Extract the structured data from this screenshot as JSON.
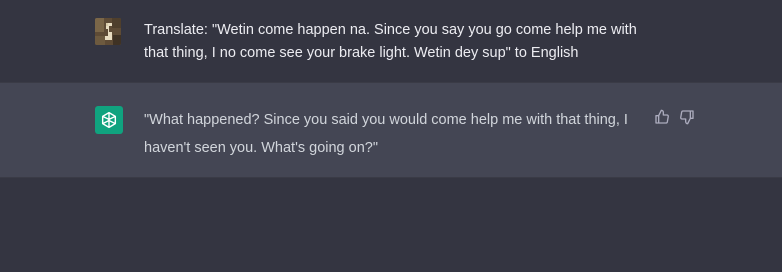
{
  "conversation": {
    "user_message": {
      "avatar_icon": "user-avatar-image",
      "text": "Translate: \"Wetin come happen na. Since you say you go come help me with that thing, I no come see your brake light. Wetin dey sup\" to English"
    },
    "assistant_message": {
      "avatar_icon": "openai-logo-icon",
      "text": "\"What happened? Since you said you would come help me with that thing, I haven't seen you. What's going on?\"",
      "feedback": {
        "thumbs_up_icon": "thumbs-up-icon",
        "thumbs_down_icon": "thumbs-down-icon"
      }
    }
  },
  "colors": {
    "background": "#343541",
    "assistant_row": "#444654",
    "assistant_avatar": "#10a37f",
    "text": "#ececf1",
    "icon": "#acacbe"
  }
}
